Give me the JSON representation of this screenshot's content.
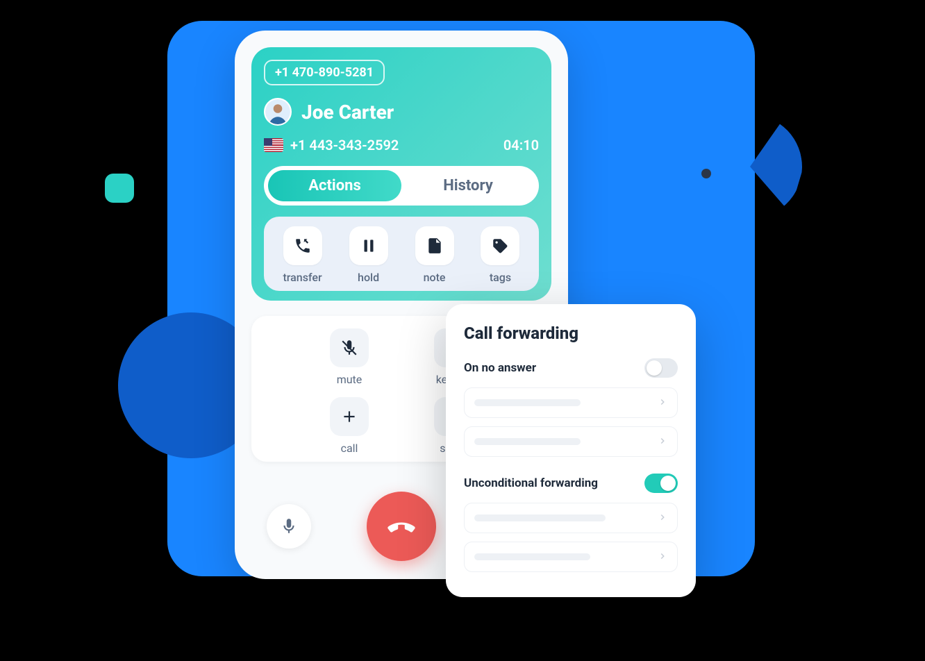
{
  "call": {
    "outbound_number": "+1 470-890-5281",
    "contact_name": "Joe Carter",
    "inbound_number": "+1 443-343-2592",
    "duration": "04:10",
    "flag_icon": "us-flag-icon"
  },
  "tabs": {
    "actions": "Actions",
    "history": "History",
    "active_index": 0
  },
  "actions": {
    "transfer": "transfer",
    "hold": "hold",
    "note": "note",
    "tags": "tags"
  },
  "secondary": {
    "mute": "mute",
    "keypad": "keypad",
    "call": "call",
    "share": "share"
  },
  "forwarding": {
    "title": "Call forwarding",
    "no_answer": {
      "label": "On no answer",
      "enabled": false
    },
    "unconditional": {
      "label": "Unconditional forwarding",
      "enabled": true
    }
  },
  "colors": {
    "accent_teal": "#22cbb8",
    "accent_blue": "#1985ff",
    "danger": "#ec5a57"
  }
}
